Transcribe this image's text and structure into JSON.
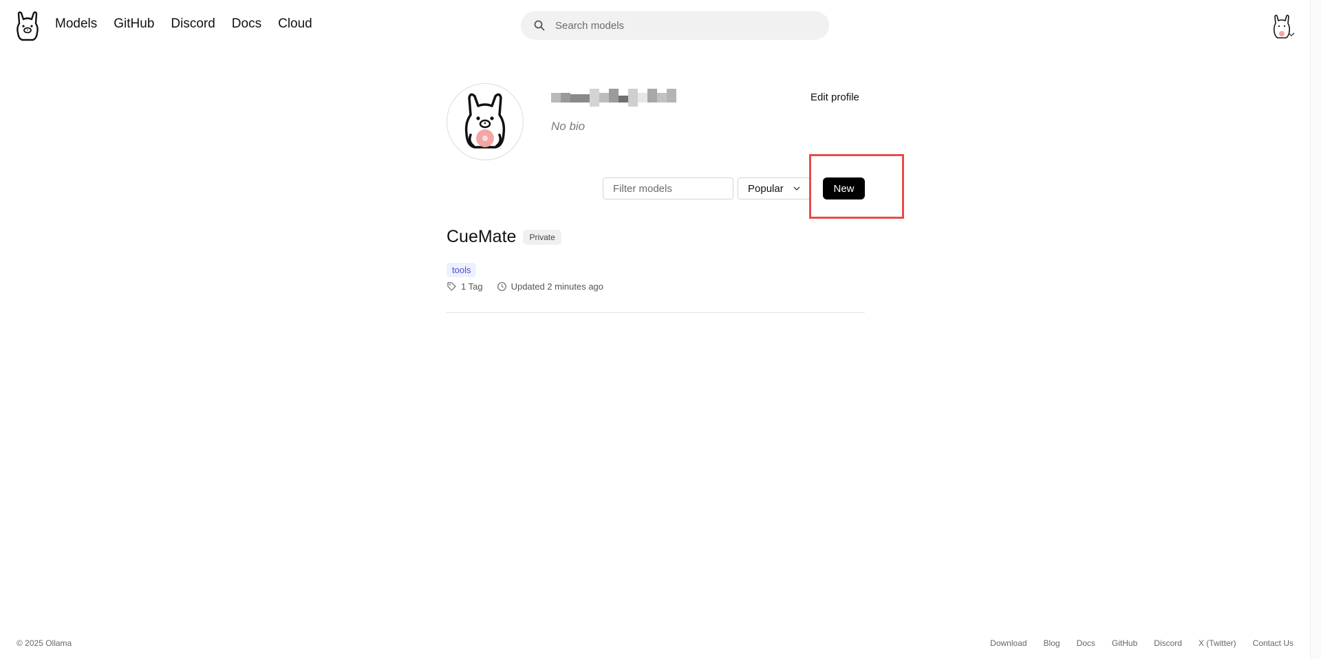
{
  "header": {
    "nav": [
      "Models",
      "GitHub",
      "Discord",
      "Docs",
      "Cloud"
    ],
    "search_placeholder": "Search models"
  },
  "profile": {
    "bio": "No bio",
    "edit_label": "Edit profile"
  },
  "controls": {
    "filter_placeholder": "Filter models",
    "sort_selected": "Popular",
    "new_label": "New"
  },
  "models": [
    {
      "name": "CueMate",
      "visibility": "Private",
      "capability": "tools",
      "tags": "1 Tag",
      "updated": "Updated 2 minutes ago"
    }
  ],
  "footer": {
    "copyright": "© 2025 Ollama",
    "links": [
      "Download",
      "Blog",
      "Docs",
      "GitHub",
      "Discord",
      "X (Twitter)",
      "Contact Us"
    ]
  },
  "colors": {
    "highlight": "#e84a4a",
    "button": "#000000",
    "capability_tag_bg": "#eef0ff",
    "capability_tag_text": "#4851c7"
  },
  "icons": [
    "ollama-logo",
    "search-icon",
    "user-avatar",
    "chevron-down-icon",
    "tag-icon",
    "clock-icon"
  ]
}
